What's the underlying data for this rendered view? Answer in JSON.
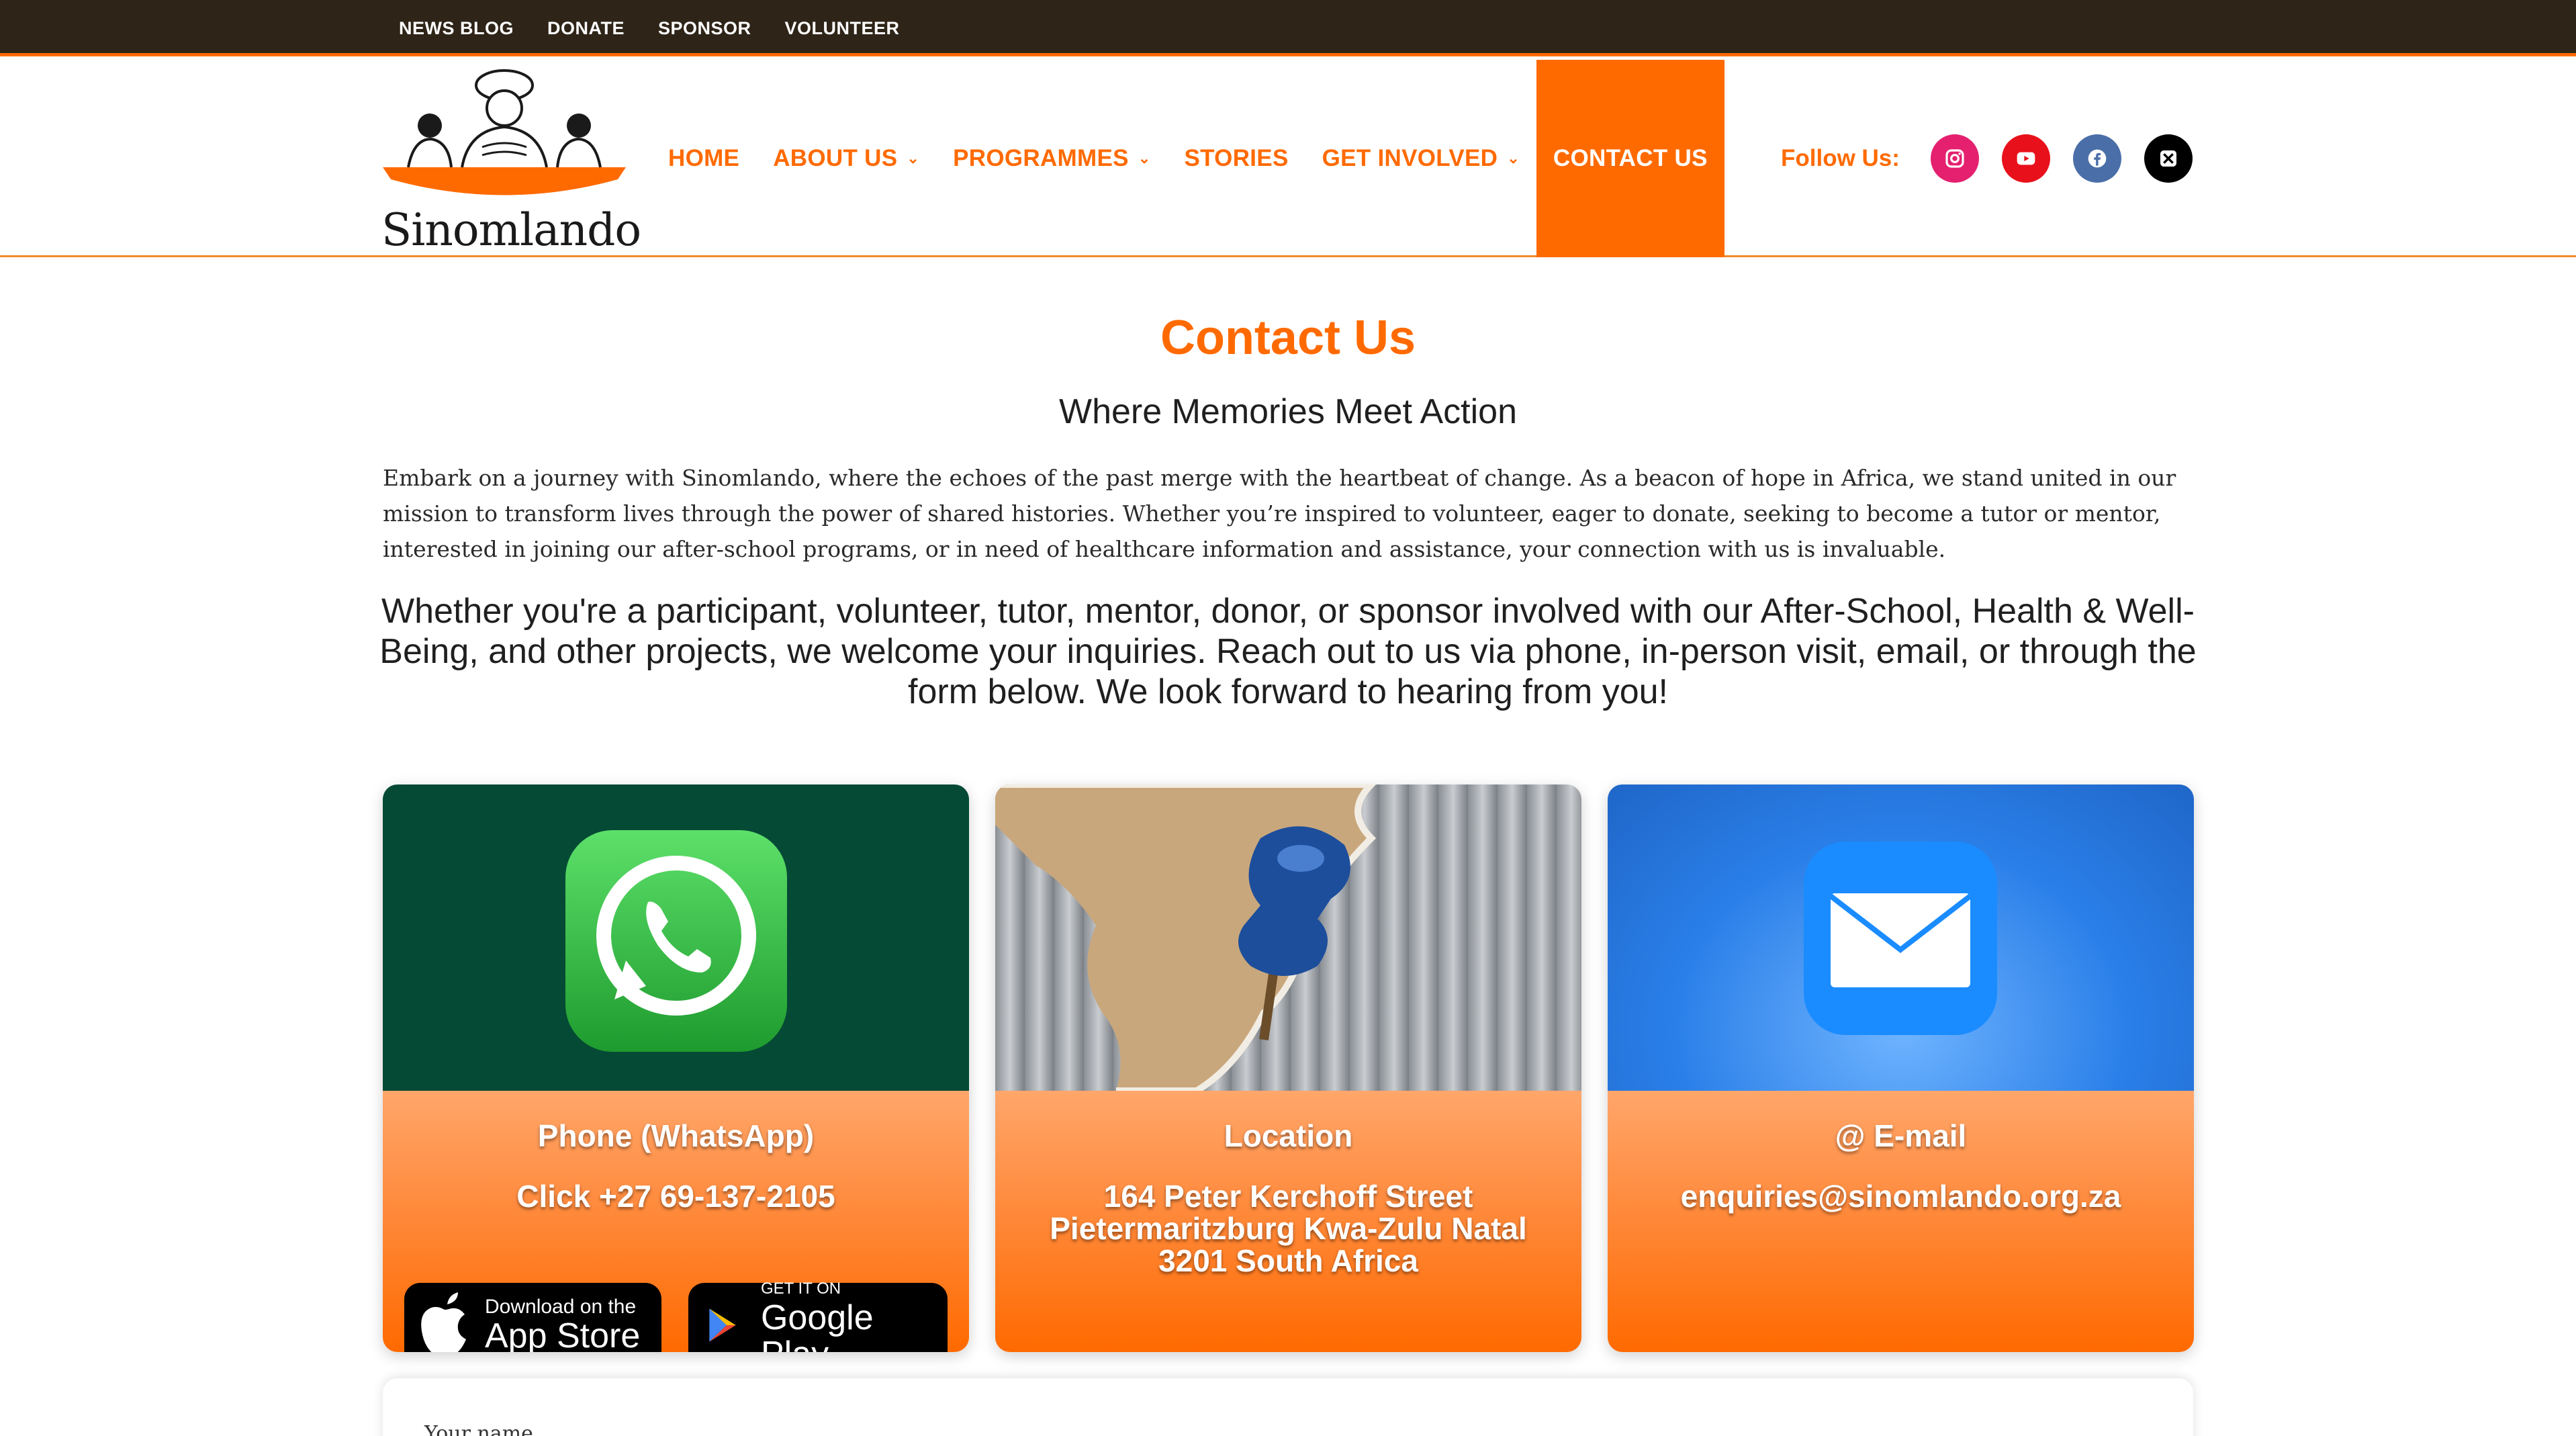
{
  "topbar": {
    "links": [
      "NEWS BLOG",
      "DONATE",
      "SPONSOR",
      "VOLUNTEER"
    ]
  },
  "logo": {
    "text": "Sinomlando"
  },
  "nav": {
    "home": "HOME",
    "about": "ABOUT US",
    "programmes": "PROGRAMMES",
    "stories": "STORIES",
    "get_involved": "GET INVOLVED",
    "contact": "CONTACT US",
    "caret": "⌄"
  },
  "follow": {
    "label": "Follow Us:",
    "icons": [
      "instagram-icon",
      "youtube-icon",
      "facebook-icon",
      "x-icon"
    ]
  },
  "page": {
    "title": "Contact Us",
    "subtitle": "Where Memories Meet Action",
    "intro": "Embark on a journey with Sinomlando, where the echoes of the past merge with the heartbeat of change. As a beacon of hope in Africa, we stand united in our mission to transform lives through the power of shared histories. Whether you’re inspired to volunteer, eager to donate, seeking to become a tutor or mentor, interested in joining our after-school programs, or in need of healthcare information and assistance, your connection with us is invaluable.",
    "invite": "Whether you're a participant, volunteer, tutor, mentor, donor, or sponsor involved with our After-School, Health & Well-Being, and other projects, we welcome your inquiries. Reach out to us via phone, in-person visit, email, or through the form below. We look forward to hearing from you!"
  },
  "cards": {
    "phone": {
      "heading": "Phone (WhatsApp)",
      "line": "Click +27 69-137-2105",
      "appstore_small": "Download on the",
      "appstore_big": "App Store",
      "googleplay_small": "GET IT ON",
      "googleplay_big": "Google Play"
    },
    "location": {
      "heading": "Location",
      "line1": "164 Peter Kerchoff Street",
      "line2": "Pietermaritzburg Kwa-Zulu Natal",
      "line3": "3201 South Africa"
    },
    "email": {
      "heading": "@ E-mail",
      "line": "enquiries@sinomlando.org.za"
    }
  },
  "form": {
    "name_label": "Your name"
  },
  "colors": {
    "accent": "#ff6a00",
    "topbar": "#2e2418",
    "whatsapp_bg": "#054a35",
    "email_bg": "#2a7fe8"
  }
}
